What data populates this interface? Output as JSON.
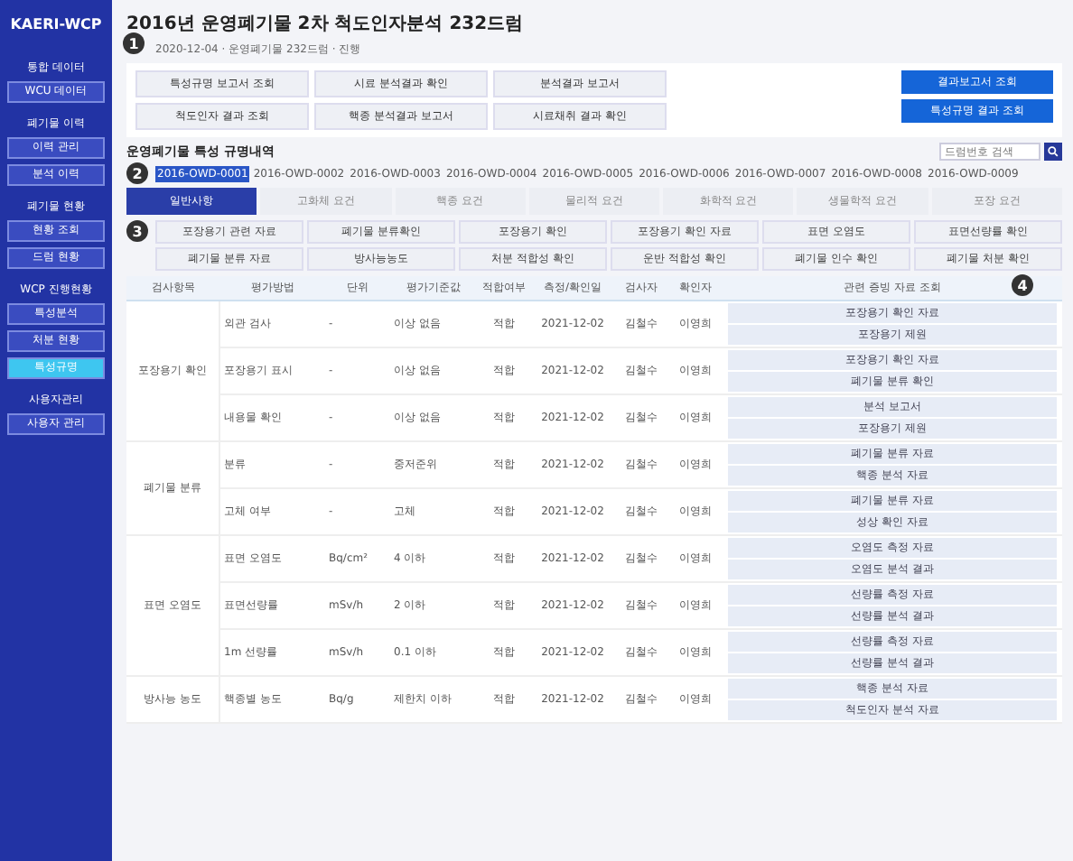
{
  "sidebar": {
    "logo": "KAERI-WCP",
    "groups": [
      {
        "title": "통합 데이터",
        "items": [
          {
            "label": "WCU 데이터",
            "selected": false
          }
        ]
      },
      {
        "title": "폐기물 이력",
        "items": [
          {
            "label": "이력 관리",
            "selected": false
          },
          {
            "label": "분석 이력",
            "selected": false
          }
        ]
      },
      {
        "title": "폐기물 현황",
        "items": [
          {
            "label": "현황 조회",
            "selected": false
          },
          {
            "label": "드럼 현황",
            "selected": false
          }
        ]
      },
      {
        "title": "WCP 진행현황",
        "items": [
          {
            "label": "특성분석",
            "selected": false
          },
          {
            "label": "처분 현황",
            "selected": false
          },
          {
            "label": "특성규명",
            "selected": true
          }
        ]
      },
      {
        "title": "사용자관리",
        "items": [
          {
            "label": "사용자 관리",
            "selected": false
          }
        ]
      }
    ]
  },
  "header": {
    "title": "2016년 운영폐기물 2차 척도인자분석 232드럼",
    "meta": "2020-12-04 · 운영폐기물 232드럼 · 진행",
    "callout": "1"
  },
  "filters": [
    "특성규명 보고서 조회",
    "시료 분석결과 확인",
    "분석결과 보고서",
    "척도인자 결과 조회",
    "핵종 분석결과 보고서",
    "시료채취 결과 확인"
  ],
  "actions": [
    "결과보고서 조회",
    "특성규명 결과 조회"
  ],
  "search": {
    "placeholder": "드럼번호 검색"
  },
  "section": {
    "title": "운영폐기물 특성 규명내역",
    "callout": "2",
    "chips": [
      {
        "label": "2016-OWD-0001",
        "selected": true
      },
      {
        "label": "2016-OWD-0002",
        "selected": false
      },
      {
        "label": "2016-OWD-0003",
        "selected": false
      },
      {
        "label": "2016-OWD-0004",
        "selected": false
      },
      {
        "label": "2016-OWD-0005",
        "selected": false
      },
      {
        "label": "2016-OWD-0006",
        "selected": false
      },
      {
        "label": "2016-OWD-0007",
        "selected": false
      },
      {
        "label": "2016-OWD-0008",
        "selected": false
      },
      {
        "label": "2016-OWD-0009",
        "selected": false
      }
    ]
  },
  "tabs": [
    {
      "label": "일반사항",
      "selected": true
    },
    {
      "label": "고화체 요건",
      "selected": false
    },
    {
      "label": "핵종 요건",
      "selected": false
    },
    {
      "label": "물리적 요건",
      "selected": false
    },
    {
      "label": "화학적 요건",
      "selected": false
    },
    {
      "label": "생물학적 요건",
      "selected": false
    },
    {
      "label": "포장 요건",
      "selected": false
    }
  ],
  "subtabs": {
    "callout": "3",
    "items": [
      "포장용기 관련 자료",
      "폐기물 분류확인",
      "포장용기 확인",
      "포장용기 확인 자료",
      "표면 오염도",
      "표면선량률 확인",
      "폐기물 분류 자료",
      "방사능농도",
      "처분 적합성 확인",
      "운반 적합성 확인",
      "폐기물 인수 확인",
      "폐기물 처분 확인"
    ]
  },
  "table": {
    "callout": "4",
    "columns": [
      "검사항목",
      "평가방법",
      "단위",
      "평가기준값",
      "적합여부",
      "측정/확인일",
      "검사자",
      "확인자",
      "관련 증빙 자료 조회"
    ],
    "groups": [
      {
        "item": "포장용기 확인",
        "rows": [
          {
            "method": "외관 검사",
            "unit": "-",
            "criterion": "이상 없음",
            "result": "적합",
            "date": "2021-12-02",
            "inspector": "김철수",
            "checker": "이영희",
            "docs": [
              "포장용기 확인 자료",
              "포장용기 제원"
            ]
          },
          {
            "method": "포장용기 표시",
            "unit": "-",
            "criterion": "이상 없음",
            "result": "적합",
            "date": "2021-12-02",
            "inspector": "김철수",
            "checker": "이영희",
            "docs": [
              "포장용기 확인 자료",
              "폐기물 분류 확인"
            ]
          },
          {
            "method": "내용물 확인",
            "unit": "-",
            "criterion": "이상 없음",
            "result": "적합",
            "date": "2021-12-02",
            "inspector": "김철수",
            "checker": "이영희",
            "docs": [
              "분석 보고서",
              "포장용기 제원"
            ]
          }
        ]
      },
      {
        "item": "폐기물 분류",
        "rows": [
          {
            "method": "분류",
            "unit": "-",
            "criterion": "중저준위",
            "result": "적합",
            "date": "2021-12-02",
            "inspector": "김철수",
            "checker": "이영희",
            "docs": [
              "폐기물 분류 자료",
              "핵종 분석 자료"
            ]
          },
          {
            "method": "고체 여부",
            "unit": "-",
            "criterion": "고체",
            "result": "적합",
            "date": "2021-12-02",
            "inspector": "김철수",
            "checker": "이영희",
            "docs": [
              "폐기물 분류 자료",
              "성상 확인 자료"
            ]
          }
        ]
      },
      {
        "item": "표면 오염도",
        "rows": [
          {
            "method": "표면 오염도",
            "unit": "Bq/cm²",
            "criterion": "4 이하",
            "result": "적합",
            "date": "2021-12-02",
            "inspector": "김철수",
            "checker": "이영희",
            "docs": [
              "오염도 측정 자료",
              "오염도 분석 결과"
            ]
          },
          {
            "method": "표면선량률",
            "unit": "mSv/h",
            "criterion": "2 이하",
            "result": "적합",
            "date": "2021-12-02",
            "inspector": "김철수",
            "checker": "이영희",
            "docs": [
              "선량률 측정 자료",
              "선량률 분석 결과"
            ]
          },
          {
            "method": "1m 선량률",
            "unit": "mSv/h",
            "criterion": "0.1 이하",
            "result": "적합",
            "date": "2021-12-02",
            "inspector": "김철수",
            "checker": "이영희",
            "docs": [
              "선량률 측정 자료",
              "선량률 분석 결과"
            ]
          }
        ]
      },
      {
        "item": "방사능 농도",
        "rows": [
          {
            "method": "핵종별 농도",
            "unit": "Bq/g",
            "criterion": "제한치 이하",
            "result": "적합",
            "date": "2021-12-02",
            "inspector": "김철수",
            "checker": "이영희",
            "docs": [
              "핵종 분석 자료",
              "척도인자 분석 자료"
            ]
          }
        ]
      }
    ]
  }
}
